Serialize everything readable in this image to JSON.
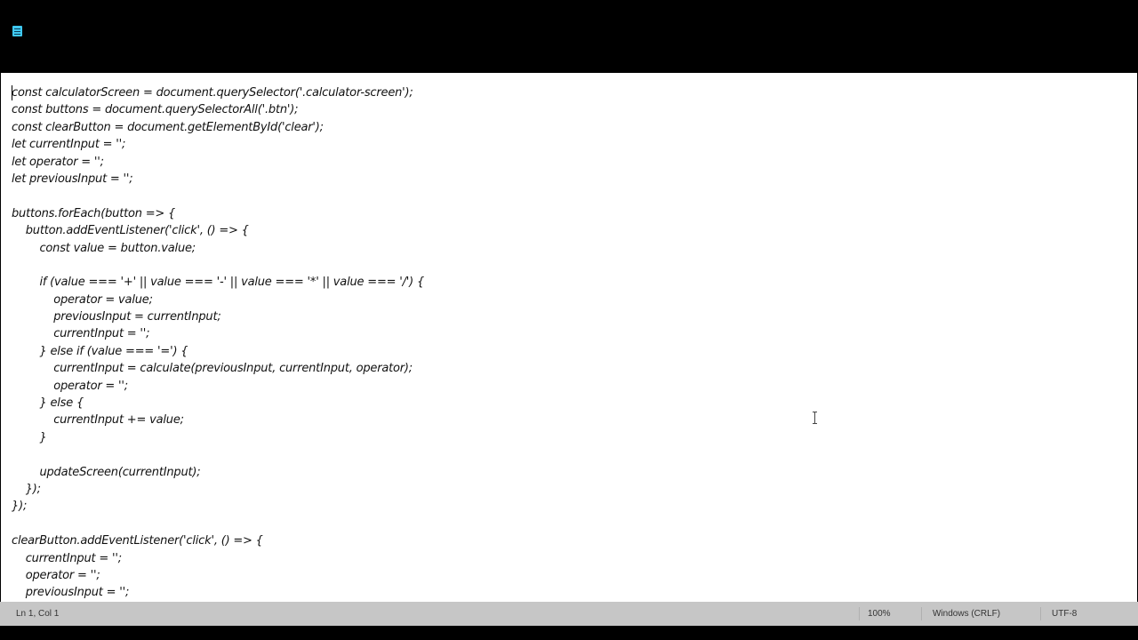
{
  "code_lines": [
    "const calculatorScreen = document.querySelector('.calculator-screen');",
    "const buttons = document.querySelectorAll('.btn');",
    "const clearButton = document.getElementById('clear');",
    "let currentInput = '';",
    "let operator = '';",
    "let previousInput = '';",
    "",
    "buttons.forEach(button => {",
    "    button.addEventListener('click', () => {",
    "        const value = button.value;",
    "",
    "        if (value === '+' || value === '-' || value === '*' || value === '/') {",
    "            operator = value;",
    "            previousInput = currentInput;",
    "            currentInput = '';",
    "        } else if (value === '=') {",
    "            currentInput = calculate(previousInput, currentInput, operator);",
    "            operator = '';",
    "        } else {",
    "            currentInput += value;",
    "        }",
    "",
    "        updateScreen(currentInput);",
    "    });",
    "});",
    "",
    "clearButton.addEventListener('click', () => {",
    "    currentInput = '';",
    "    operator = '';",
    "    previousInput = '';"
  ],
  "status": {
    "position": "Ln 1, Col 1",
    "zoom": "100%",
    "line_ending": "Windows (CRLF)",
    "encoding": "UTF-8"
  },
  "icons": {
    "app": "notepad-icon",
    "cursor": "text-cursor-icon"
  },
  "colors": {
    "background": "#000000",
    "editor": "#ffffff",
    "statusbar": "#c6c6c6",
    "app_icon": "#3fc8f0"
  }
}
